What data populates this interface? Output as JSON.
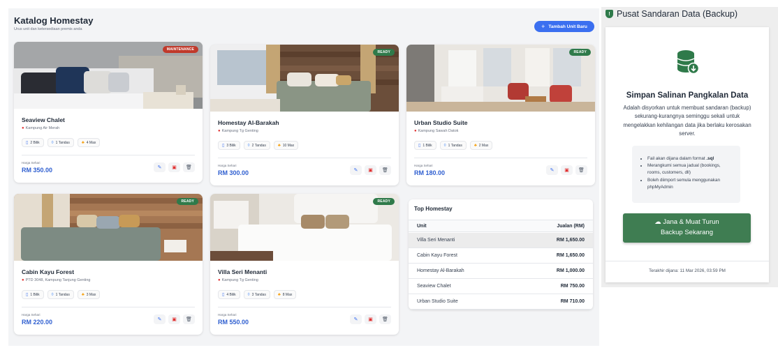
{
  "header": {
    "title": "Katalog Homestay",
    "subtitle": "Urus unit dan ketersediaan premis anda",
    "add_button": "Tambah Unit Baru"
  },
  "units": [
    {
      "name": "Seaview Chalet",
      "location": "Kampung Air Merah",
      "status": "MAINTENANCE",
      "rooms": "2 Bilik",
      "baths": "1 Tandas",
      "guests": "4 Max",
      "price_label": "Harga Sehari",
      "price": "RM 350.00"
    },
    {
      "name": "Homestay Al-Barakah",
      "location": "Kampung Tg Genting",
      "status": "READY",
      "rooms": "3 Bilik",
      "baths": "2 Tandas",
      "guests": "10 Max",
      "price_label": "Harga Sehari",
      "price": "RM 300.00"
    },
    {
      "name": "Urban Studio Suite",
      "location": "Kampung Sawah Datok",
      "status": "READY",
      "rooms": "1 Bilik",
      "baths": "1 Tandas",
      "guests": "2 Max",
      "price_label": "Harga Sehari",
      "price": "RM 180.00"
    },
    {
      "name": "Cabin Kayu Forest",
      "location": "PTD 3048, Kampung Tanjung Genting",
      "status": "READY",
      "rooms": "1 Bilik",
      "baths": "1 Tandas",
      "guests": "3 Max",
      "price_label": "Harga Sehari",
      "price": "RM 220.00"
    },
    {
      "name": "Villa Seri Menanti",
      "location": "Kampung Tg Genting",
      "status": "READY",
      "rooms": "4 Bilik",
      "baths": "3 Tandas",
      "guests": "8 Max",
      "price_label": "Harga Sehari",
      "price": "RM 550.00"
    }
  ],
  "top_homestay": {
    "title": "Top Homestay",
    "columns": [
      "Unit",
      "Jualan (RM)"
    ],
    "rows": [
      {
        "unit": "Villa Seri Menanti",
        "sales": "RM 1,650.00"
      },
      {
        "unit": "Cabin Kayu Forest",
        "sales": "RM 1,650.00"
      },
      {
        "unit": "Homestay Al-Barakah",
        "sales": "RM 1,000.00"
      },
      {
        "unit": "Seaview Chalet",
        "sales": "RM 750.00"
      },
      {
        "unit": "Urban Studio Suite",
        "sales": "RM 710.00"
      }
    ]
  },
  "backup": {
    "heading": "Pusat Sandaran Data (Backup)",
    "title": "Simpan Salinan Pangkalan Data",
    "description": "Adalah disyorkan untuk membuat sandaran (backup) sekurang-kurangnya seminggu sekali untuk mengelakkan kehilangan data jika berlaku kerosakan server.",
    "info_1_prefix": "Fail akan dijana dalam format ",
    "info_1_format": ".sql",
    "info_2": "Merangkumi semua jadual (bookings, rooms, customers, dll)",
    "info_3": "Boleh diimport semula menggunakan phpMyAdmin",
    "button_line1": "Jana & Muat Turun",
    "button_line2": "Backup Sekarang",
    "last_generated": "Terakhir dijana: 11 Mar 2026, 03:59 PM"
  },
  "icons": {
    "location": "map-pin-icon",
    "rooms": "bed-icon",
    "baths": "droplet-icon",
    "guests": "people-icon",
    "edit": "edit-icon",
    "calendar": "calendar-icon",
    "delete": "trash-icon",
    "database": "database-download-icon",
    "cloud": "cloud-download-icon",
    "shield": "shield-icon"
  },
  "colors": {
    "accent": "#3b6ff0",
    "ready": "#2f7a4a",
    "maintenance": "#c0392b",
    "backup_button": "#3f7d52"
  }
}
